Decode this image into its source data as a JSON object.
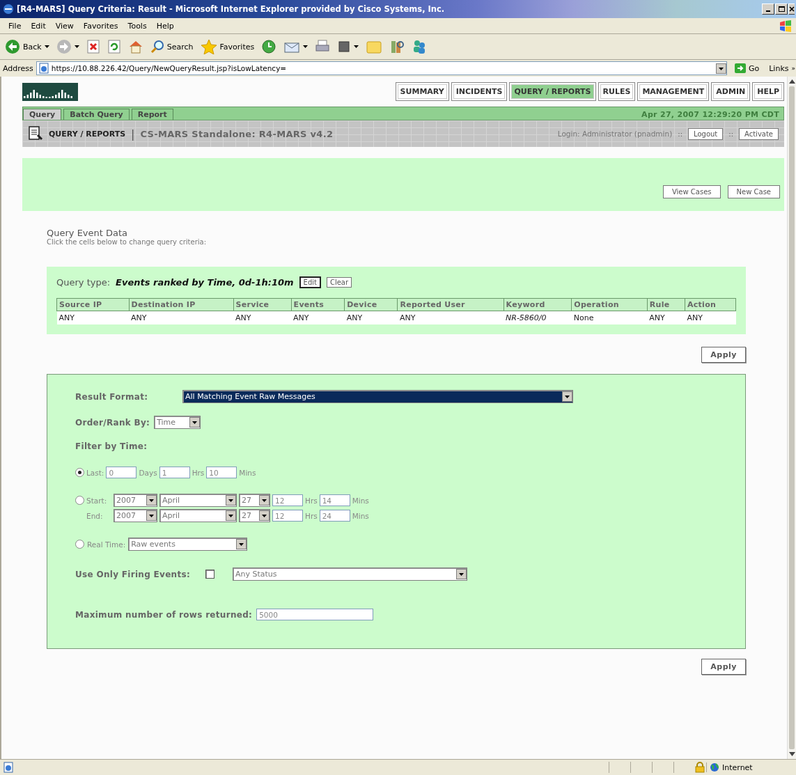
{
  "window": {
    "title": "[R4-MARS] Query Criteria: Result - Microsoft Internet Explorer provided by Cisco Systems, Inc."
  },
  "menu": [
    "File",
    "Edit",
    "View",
    "Favorites",
    "Tools",
    "Help"
  ],
  "toolbar": [
    {
      "kind": "back",
      "label": "Back"
    },
    {
      "kind": "forward"
    },
    {
      "kind": "stop"
    },
    {
      "kind": "refresh"
    },
    {
      "kind": "home"
    },
    {
      "kind": "search",
      "label": "Search"
    },
    {
      "kind": "favorites",
      "label": "Favorites"
    },
    {
      "kind": "history"
    },
    {
      "kind": "mail"
    },
    {
      "kind": "print"
    },
    {
      "kind": "edit"
    },
    {
      "kind": "folder"
    },
    {
      "kind": "research"
    },
    {
      "kind": "messenger"
    }
  ],
  "address": {
    "label": "Address",
    "url": "https://10.88.226.42/Query/NewQueryResult.jsp?isLowLatency=",
    "go": "Go",
    "links": "Links",
    "more": "»"
  },
  "nav_tabs": [
    {
      "label": "SUMMARY",
      "selected": false
    },
    {
      "label": "INCIDENTS",
      "selected": false
    },
    {
      "label": "QUERY / REPORTS",
      "selected": true
    },
    {
      "label": "RULES",
      "selected": false
    },
    {
      "label": "MANAGEMENT",
      "selected": false
    },
    {
      "label": "ADMIN",
      "selected": false
    },
    {
      "label": "HELP",
      "selected": false
    }
  ],
  "sub_tabs": [
    {
      "label": "Query",
      "selected": true
    },
    {
      "label": "Batch Query",
      "selected": false
    },
    {
      "label": "Report",
      "selected": false
    }
  ],
  "datetime": "Apr 27, 2007 12:29:20 PM CDT",
  "page_header": {
    "section": "QUERY / REPORTS",
    "divider": "|",
    "title": "CS-MARS Standalone: R4-MARS v4.2",
    "login": "Login: Administrator (pnadmin)",
    "sep_1": "::",
    "logout": "Logout",
    "sep_2": "::",
    "activate": "Activate"
  },
  "case_buttons": [
    "View Cases",
    "New Case"
  ],
  "query_event_data": {
    "heading": "Query Event Data",
    "hint": "Click the cells below to change query criteria:",
    "query_type_label": "Query type:",
    "query_type_value": "Events ranked by Time, 0d-1h:10m",
    "edit": "Edit",
    "clear": "Clear",
    "columns": [
      "Source IP",
      "Destination IP",
      "Service",
      "Events",
      "Device",
      "Reported User",
      "Keyword",
      "Operation",
      "Rule",
      "Action"
    ],
    "rows": [
      [
        {
          "text": "ANY",
          "italic": false
        },
        {
          "text": "ANY",
          "italic": false
        },
        {
          "text": "ANY",
          "italic": false
        },
        {
          "text": "ANY",
          "italic": false
        },
        {
          "text": "ANY",
          "italic": false
        },
        {
          "text": "ANY",
          "italic": false
        },
        {
          "text": "NR-5860/0",
          "italic": true
        },
        {
          "text": "None",
          "italic": false
        },
        {
          "text": "ANY",
          "italic": false
        },
        {
          "text": "ANY",
          "italic": false
        }
      ]
    ]
  },
  "apply_top": "Apply",
  "criteria": {
    "result_format": {
      "label": "Result Format:",
      "value": "All Matching Event Raw Messages",
      "highlighted": true
    },
    "order_by": {
      "label": "Order/Rank By:",
      "value": "Time"
    },
    "filter_heading": "Filter by Time:",
    "last": {
      "selected": true,
      "label": "Last:",
      "days": "0",
      "days_label": "Days",
      "hrs": "1",
      "hrs_label": "Hrs",
      "mins": "10",
      "mins_label": "Mins"
    },
    "range": {
      "selected": false,
      "start_label": "Start:",
      "end_label": "End:",
      "start": {
        "year": "2007",
        "month": "April",
        "day": "27",
        "hrs": "12",
        "hrs_label": "Hrs",
        "mins": "14",
        "mins_label": "Mins"
      },
      "end": {
        "year": "2007",
        "month": "April",
        "day": "27",
        "hrs": "12",
        "hrs_label": "Hrs",
        "mins": "24",
        "mins_label": "Mins"
      }
    },
    "real_time": {
      "selected": false,
      "label": "Real Time:",
      "value": "Raw events"
    },
    "firing": {
      "label": "Use Only Firing Events:",
      "checked": false,
      "status": "Any Status"
    },
    "max_rows": {
      "label": "Maximum number of rows returned:",
      "value": "5000"
    }
  },
  "apply_bottom": "Apply",
  "status_bar": {
    "zone": "Internet"
  }
}
